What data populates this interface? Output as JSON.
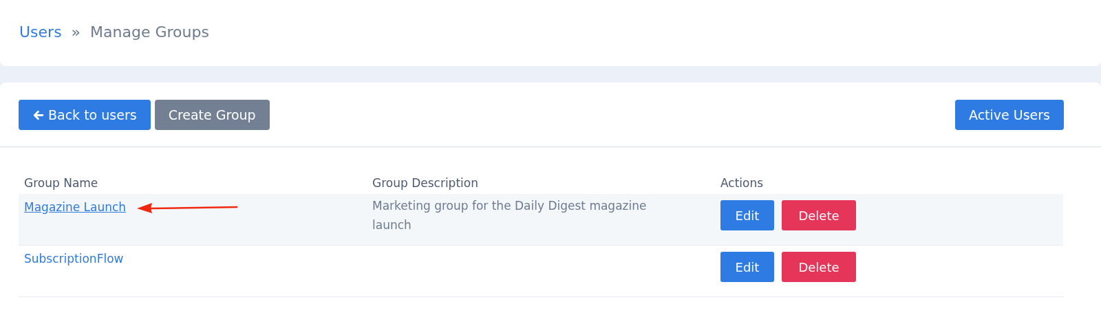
{
  "breadcrumb": {
    "link": "Users",
    "separator": "»",
    "current": "Manage Groups"
  },
  "toolbar": {
    "left_buttons": [
      {
        "label": "Back to users",
        "kind": "primary",
        "icon": true
      },
      {
        "label": "Create Group",
        "kind": "secondary",
        "icon": false
      }
    ],
    "right_buttons": [
      {
        "label": "Active Users",
        "kind": "primary",
        "icon": false
      }
    ]
  },
  "table": {
    "columns": [
      "Group Name",
      "Group Description",
      "Actions"
    ],
    "rows": [
      {
        "name": "Magazine Launch",
        "description": "Marketing group for the Daily Digest magazine launch",
        "selected": true,
        "arrow": true,
        "actions": [
          "Edit",
          "Delete"
        ]
      },
      {
        "name": "SubscriptionFlow",
        "description": "",
        "selected": false,
        "arrow": false,
        "actions": [
          "Edit",
          "Delete"
        ]
      }
    ]
  }
}
